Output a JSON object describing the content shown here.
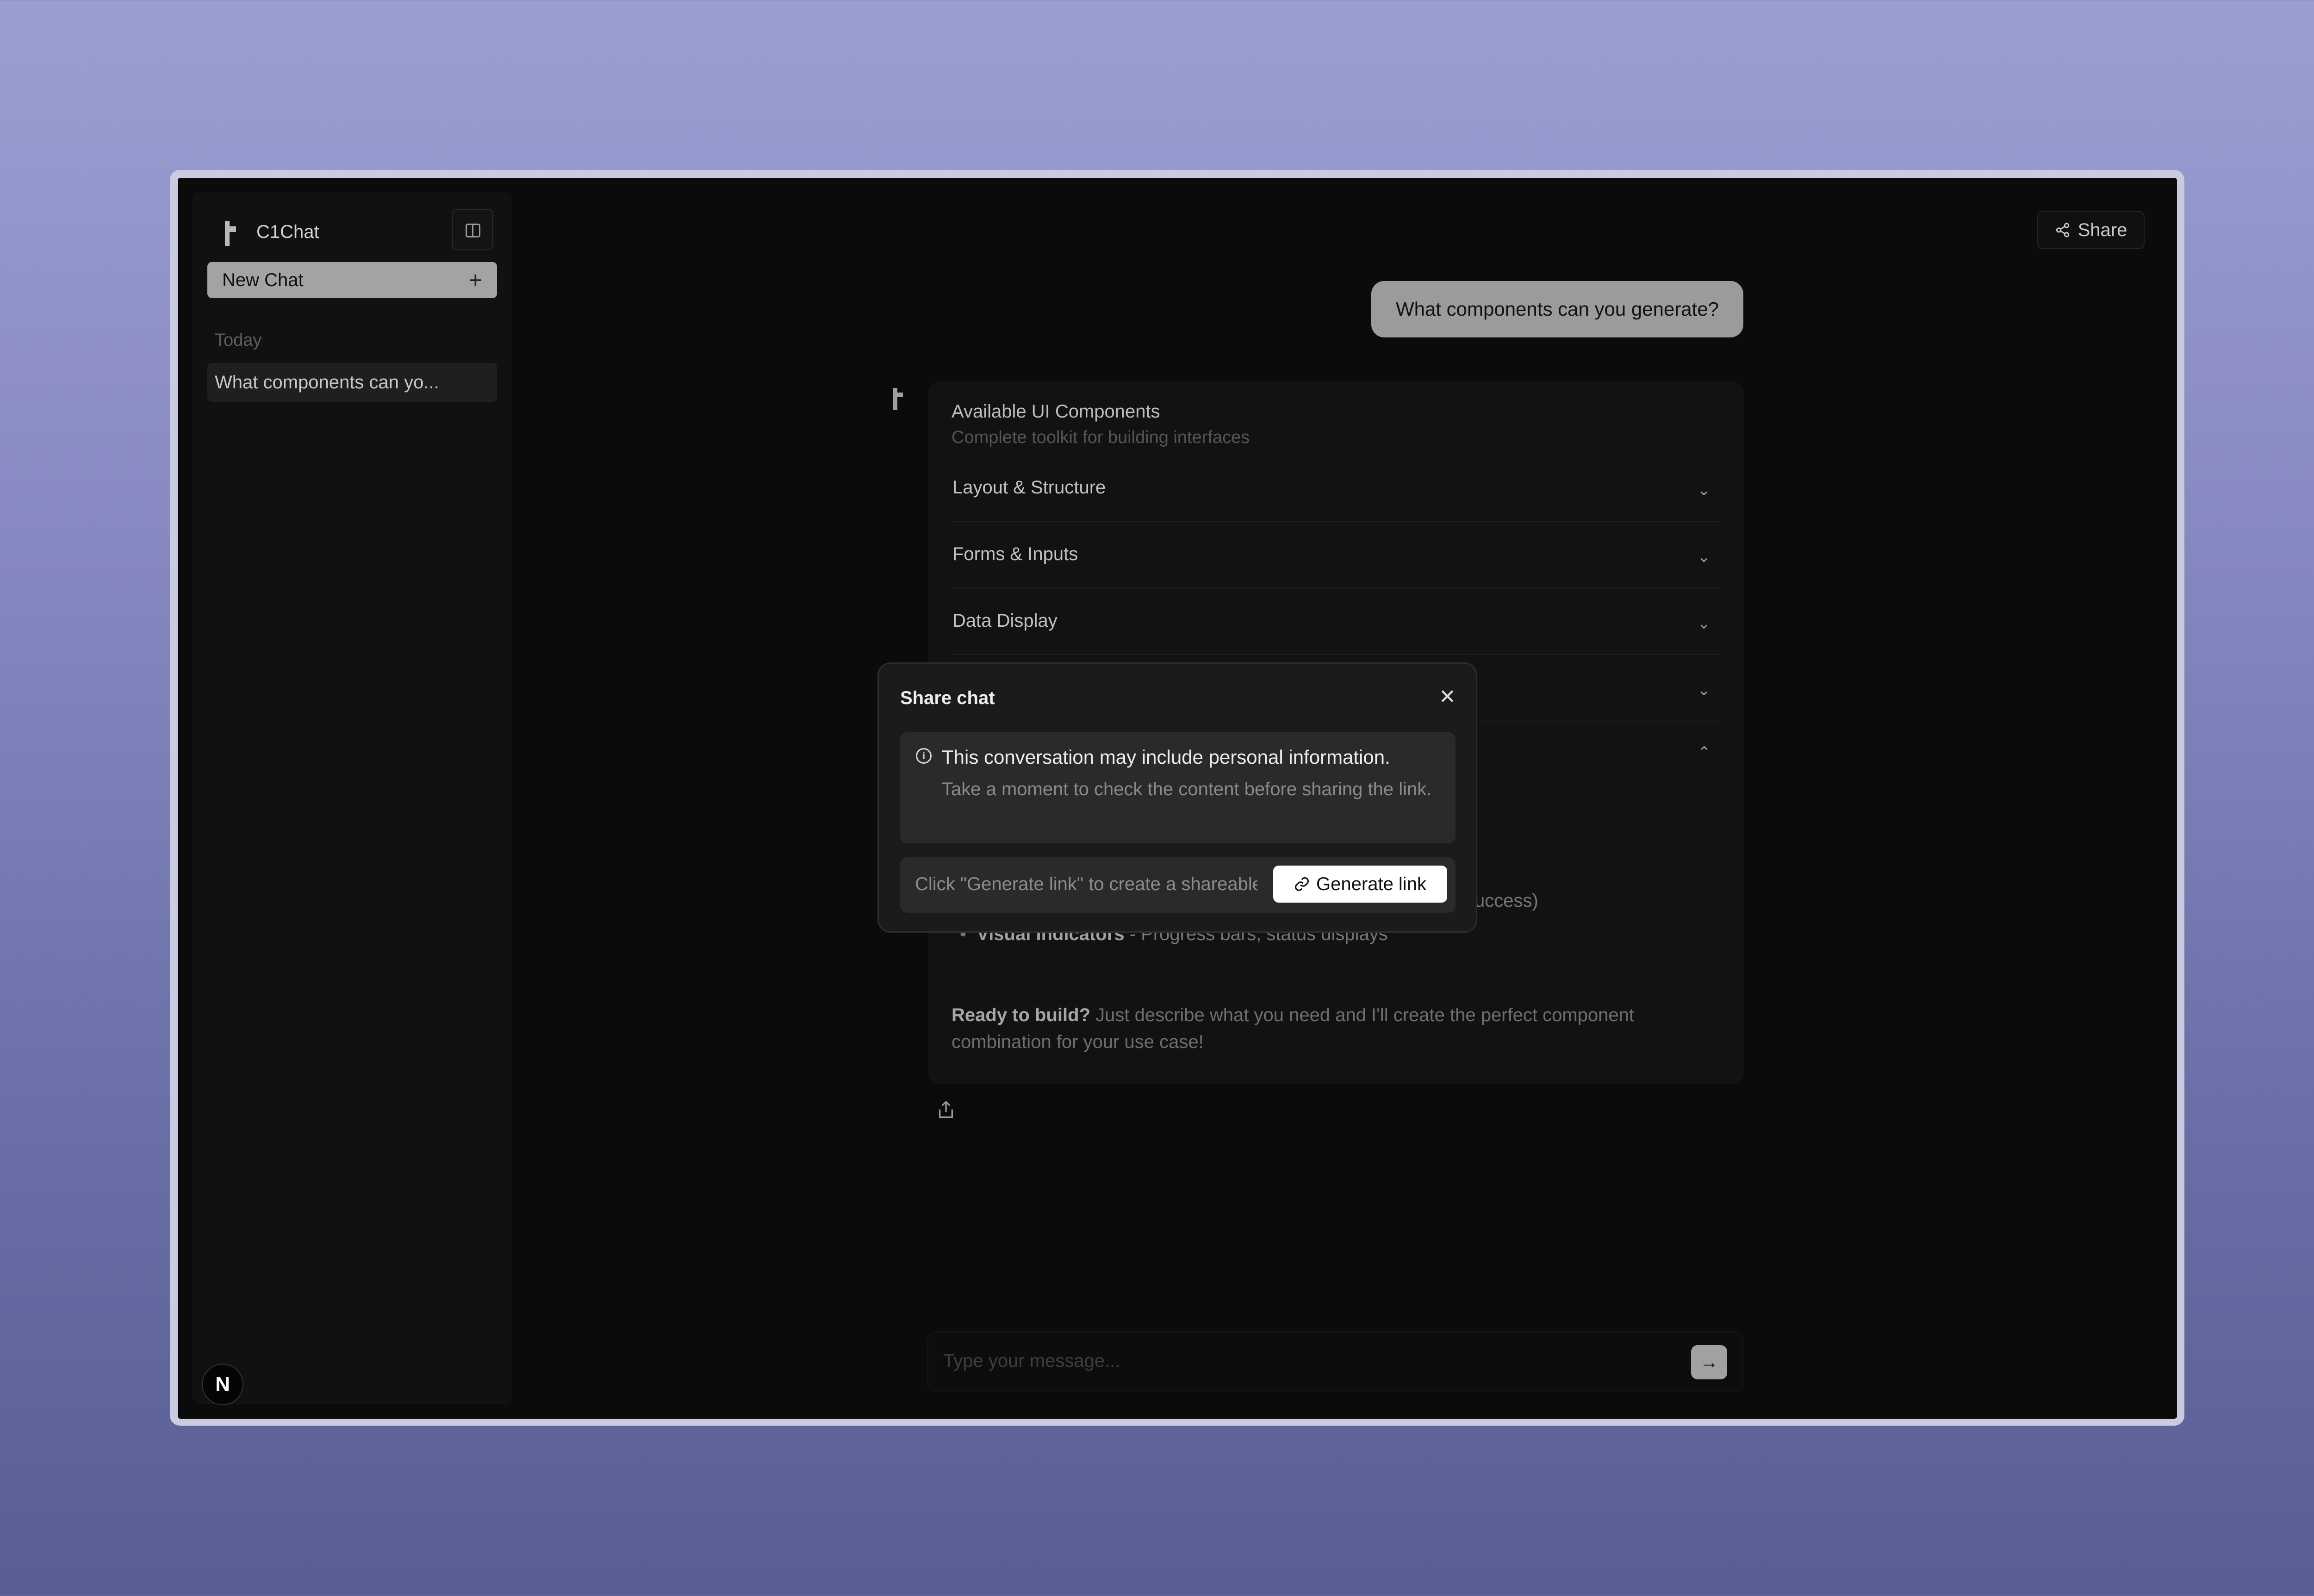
{
  "sidebar": {
    "app_name": "C1Chat",
    "new_chat_label": "New Chat",
    "new_chat_icon": "+",
    "section_label": "Today",
    "history": [
      {
        "label": "What components can yo..."
      }
    ],
    "avatar_letter": "N"
  },
  "header": {
    "share_label": "Share"
  },
  "conversation": {
    "user_message": "What components can you generate?",
    "card": {
      "title": "Available UI Components",
      "subtitle": "Complete toolkit for building interfaces",
      "sections": [
        {
          "label": "Layout & Structure",
          "expanded": false
        },
        {
          "label": "Forms & Inputs",
          "expanded": false
        },
        {
          "label": "Data Display",
          "expanded": false
        },
        {
          "label": "",
          "expanded": false
        },
        {
          "label": "",
          "expanded": true
        }
      ],
      "bullets": [
        {
          "bold": "",
          "text": "success)"
        },
        {
          "bold": "Visual Indicators",
          "text": " - Progress bars, status displays"
        }
      ],
      "ready_bold": "Ready to build?",
      "ready_text": " Just describe what you need and I'll create the perfect component combination for your use case!"
    }
  },
  "composer": {
    "placeholder": "Type your message...",
    "send_icon": "→"
  },
  "modal": {
    "title": "Share chat",
    "close_icon": "✕",
    "notice_title": "This conversation may include personal information.",
    "notice_body": "Take a moment to check the content before sharing the link.",
    "link_placeholder": "Click \"Generate link\" to create a shareable link",
    "generate_label": "Generate link"
  }
}
